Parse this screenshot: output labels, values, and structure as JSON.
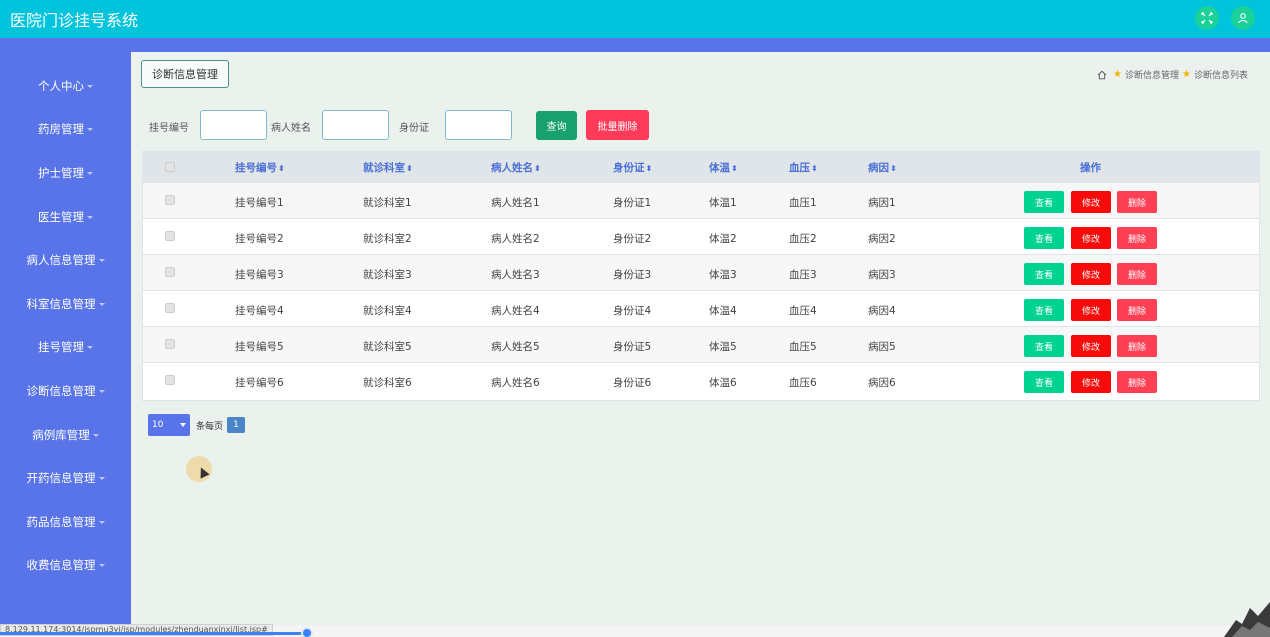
{
  "app": {
    "title": "医院门诊挂号系统"
  },
  "sidebar": {
    "items": [
      {
        "label": "个人中心"
      },
      {
        "label": "药房管理"
      },
      {
        "label": "护士管理"
      },
      {
        "label": "医生管理"
      },
      {
        "label": "病人信息管理"
      },
      {
        "label": "科室信息管理"
      },
      {
        "label": "挂号管理"
      },
      {
        "label": "诊断信息管理"
      },
      {
        "label": "病例库管理"
      },
      {
        "label": "开药信息管理"
      },
      {
        "label": "药品信息管理"
      },
      {
        "label": "收费信息管理"
      }
    ]
  },
  "page": {
    "header_button": "诊断信息管理",
    "breadcrumb": [
      "诊断信息管理",
      "诊断信息列表"
    ]
  },
  "search": {
    "field1_label": "挂号编号",
    "field2_label": "病人姓名",
    "field3_label": "身份证",
    "query_label": "查询",
    "batch_delete_label": "批量删除"
  },
  "table": {
    "columns": [
      "挂号编号",
      "就诊科室",
      "病人姓名",
      "身份证",
      "体温",
      "血压",
      "病因",
      "操作"
    ],
    "rows": [
      [
        "挂号编号1",
        "就诊科室1",
        "病人姓名1",
        "身份证1",
        "体温1",
        "血压1",
        "病因1"
      ],
      [
        "挂号编号2",
        "就诊科室2",
        "病人姓名2",
        "身份证2",
        "体温2",
        "血压2",
        "病因2"
      ],
      [
        "挂号编号3",
        "就诊科室3",
        "病人姓名3",
        "身份证3",
        "体温3",
        "血压3",
        "病因3"
      ],
      [
        "挂号编号4",
        "就诊科室4",
        "病人姓名4",
        "身份证4",
        "体温4",
        "血压4",
        "病因4"
      ],
      [
        "挂号编号5",
        "就诊科室5",
        "病人姓名5",
        "身份证5",
        "体温5",
        "血压5",
        "病因5"
      ],
      [
        "挂号编号6",
        "就诊科室6",
        "病人姓名6",
        "身份证6",
        "体温6",
        "血压6",
        "病因6"
      ]
    ],
    "actions": {
      "view": "查看",
      "edit": "修改",
      "delete": "删除"
    }
  },
  "pagination": {
    "page_size": "10",
    "per_page_label": "条每页",
    "current_page": "1"
  },
  "status": {
    "url": "8.129.11.174:3014/jspmu3yi/jsp/modules/zhenduanxinxi/list.jsp#"
  },
  "colors": {
    "topbar": "#00c3dc",
    "sidebar": "#5874e8",
    "view": "#00d28f",
    "edit": "#f60a0a",
    "delete": "#ff3f53"
  }
}
